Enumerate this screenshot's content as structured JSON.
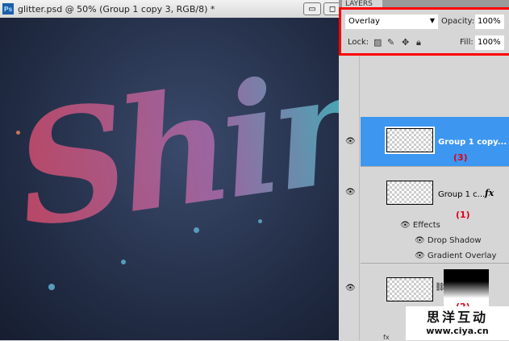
{
  "window": {
    "app_icon": "Ps",
    "title": "glitter.psd @ 50% (Group 1 copy 3, RGB/8) *",
    "minimize": "▭",
    "maximize": "◻"
  },
  "canvas": {
    "artwork_text": "Shiny"
  },
  "layers_panel": {
    "tab": "LAYERS",
    "blend_mode": "Overlay",
    "opacity_label": "Opacity:",
    "opacity": "100%",
    "lock_label": "Lock:",
    "fill_label": "Fill:",
    "fill": "100%",
    "layers": [
      {
        "name": "Group 1 copy...",
        "annotation": "(3)",
        "selected": true
      },
      {
        "name": "Group 1 c...",
        "annotation": "(1)",
        "fx": "fx",
        "effects_label": "Effects",
        "effects": [
          "Drop Shadow",
          "Gradient Overlay"
        ]
      },
      {
        "name": "",
        "annotation": "(2)"
      }
    ],
    "footer_fx": "fx"
  },
  "watermark": {
    "line1": "思洋互动",
    "line2": "www.ciya.cn"
  },
  "colors": {
    "selected": "#3d97f0",
    "annotation": "#e0001a",
    "highlight_box": "#ff0000"
  }
}
